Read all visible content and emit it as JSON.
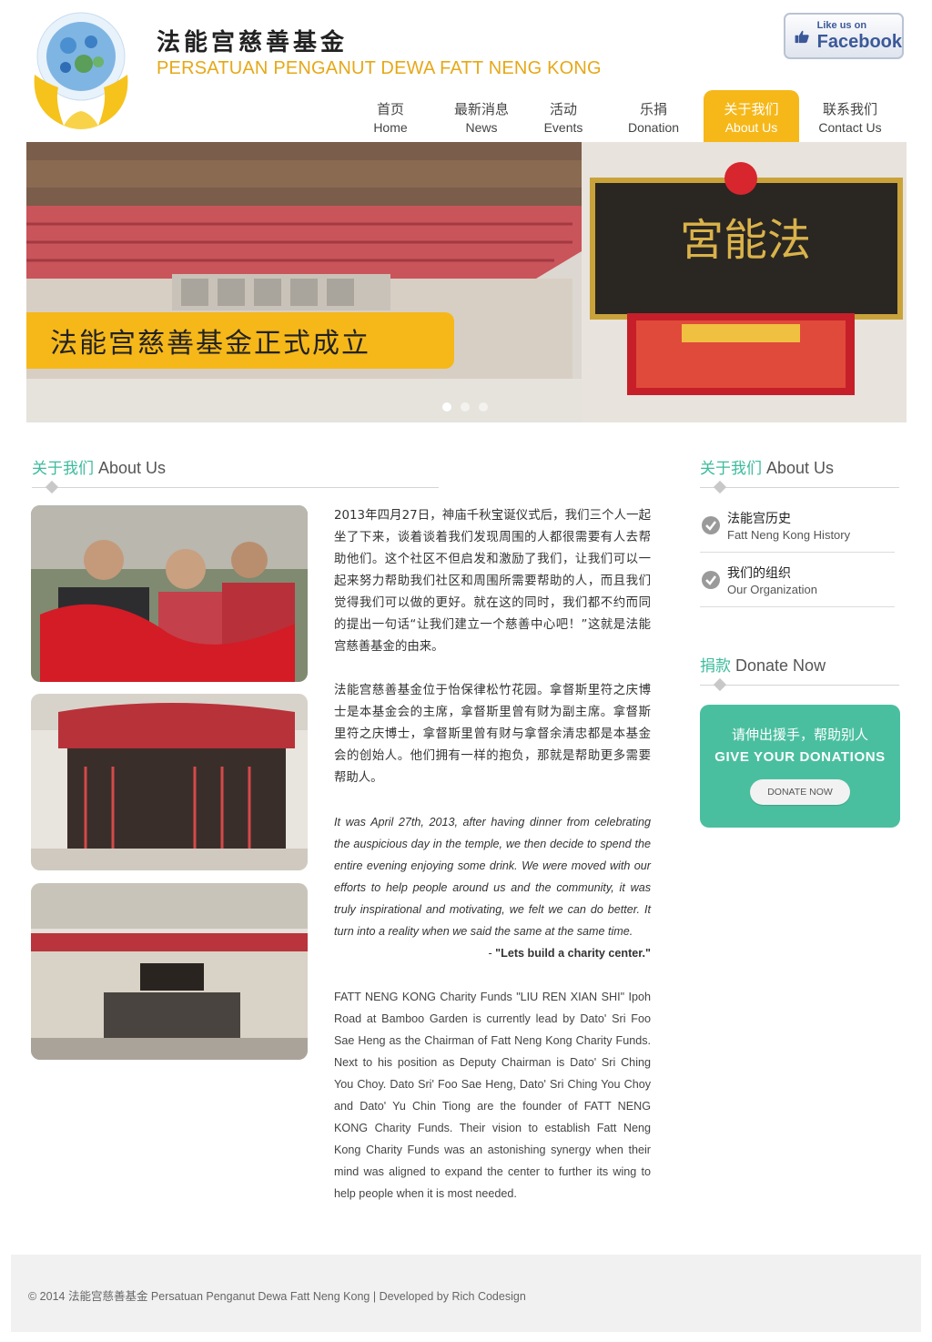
{
  "header": {
    "title_cn": "法能宫慈善基金",
    "title_en": "PERSATUAN PENGANUT DEWA FATT NENG KONG",
    "facebook": {
      "small": "Like us on",
      "big": "Facebook"
    }
  },
  "nav": [
    {
      "cn": "首页",
      "en": "Home"
    },
    {
      "cn": "最新消息",
      "en": "News"
    },
    {
      "cn": "活动",
      "en": "Events"
    },
    {
      "cn": "乐捐",
      "en": "Donation"
    },
    {
      "cn": "关于我们",
      "en": "About Us",
      "active": true
    },
    {
      "cn": "联系我们",
      "en": "Contact Us"
    }
  ],
  "banner": {
    "caption": "法能宫慈善基金正式成立",
    "slides": 3,
    "current": 1
  },
  "main": {
    "heading_cn": "关于我们",
    "heading_en": "About Us",
    "para_cn_1": "2013年四月27日，神庙千秋宝诞仪式后，我们三个人一起坐了下来，谈着谈着我们发现周围的人都很需要有人去帮助他们。这个社区不但启发和激励了我们，让我们可以一起来努力帮助我们社区和周围所需要帮助的人，而且我们觉得我们可以做的更好。就在这的同时，我们都不约而同的提出一句话“让我们建立一个慈善中心吧！”这就是法能宫慈善基金的由来。",
    "para_cn_2": "法能宫慈善基金位于怡保律松竹花园。拿督斯里符之庆博士是本基金会的主席，拿督斯里曾有财为副主席。拿督斯里符之庆博士，拿督斯里曾有财与拿督余清忠都是本基金会的创始人。他们拥有一样的抱负，那就是帮助更多需要帮助人。",
    "para_en_italic": "It was April 27th, 2013, after having dinner from celebrating the auspicious day in the temple, we then decide to spend the entire evening enjoying some drink. We were moved with our efforts to help people around us and the community, it was truly inspirational and motivating, we felt we can do better. It turn into a reality when we said the same at the same time.",
    "quote_prefix": "- ",
    "quote": "\"Lets build a charity center.\"",
    "para_en": "FATT NENG KONG Charity Funds \"LIU REN XIAN SHI\" Ipoh Road at Bamboo Garden is currently lead by Dato' Sri Foo Sae Heng as the Chairman of Fatt Neng Kong Charity Funds. Next to his position as Deputy Chairman is Dato' Sri Ching You Choy. Dato Sri' Foo Sae Heng, Dato' Sri Ching You Choy and Dato' Yu Chin Tiong are the founder of FATT NENG KONG Charity Funds. Their vision to establish Fatt Neng Kong Charity Funds was an astonishing synergy when their mind was aligned to expand the center to further its wing to help people when it is most needed."
  },
  "sidebar": {
    "about_heading_cn": "关于我们",
    "about_heading_en": "About Us",
    "items": [
      {
        "cn": "法能宫历史",
        "en": "Fatt Neng Kong History"
      },
      {
        "cn": "我们的组织",
        "en": "Our Organization"
      }
    ],
    "donate_heading_cn": "捐款",
    "donate_heading_en": "Donate Now",
    "donate_box": {
      "cn": "请伸出援手，帮助别人",
      "en": "GIVE YOUR DONATIONS",
      "button": "DONATE NOW"
    }
  },
  "footer": {
    "text": "© 2014 法能宫慈善基金  Persatuan Penganut Dewa Fatt Neng Kong  |    Developed by Rich Codesign"
  },
  "colors": {
    "accent_yellow": "#f6b819",
    "accent_green": "#3dbb9d",
    "donate_bg": "#4abfa0",
    "title_gold": "#e6a817"
  }
}
